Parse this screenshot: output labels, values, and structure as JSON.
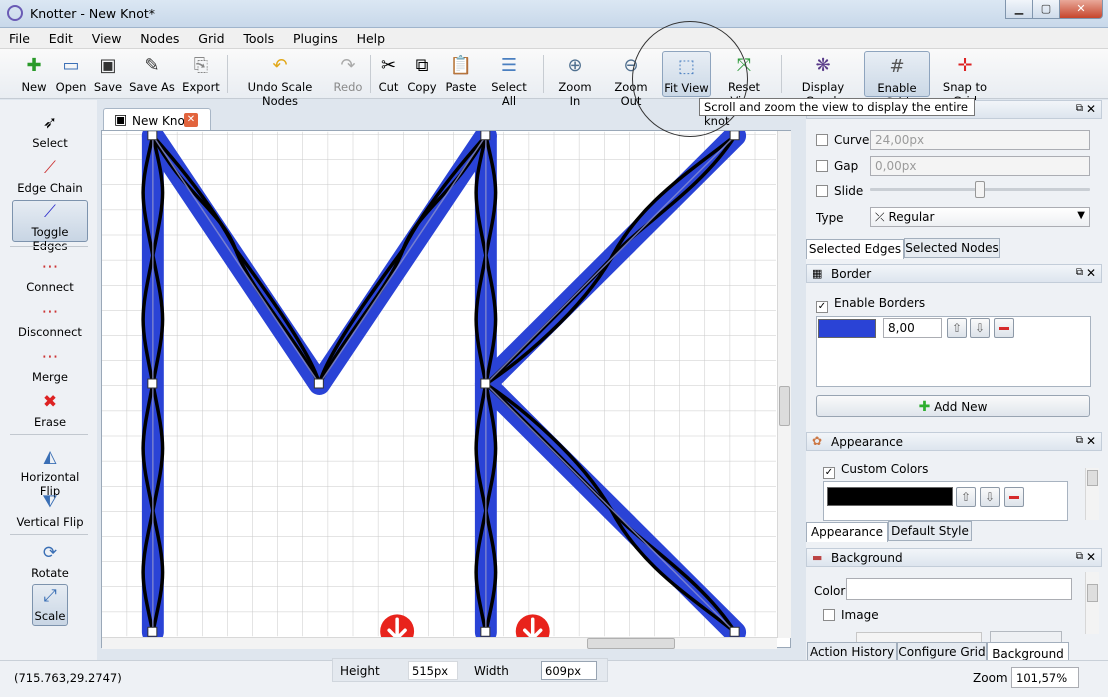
{
  "window": {
    "title": "Knotter - New Knot*",
    "min": "▁",
    "max": "▢",
    "close": "✕"
  },
  "menu": [
    "File",
    "Edit",
    "View",
    "Nodes",
    "Grid",
    "Tools",
    "Plugins",
    "Help"
  ],
  "toolbar": {
    "new": "New",
    "open": "Open",
    "save": "Save",
    "save_as": "Save As",
    "export": "Export",
    "undo": "Undo Scale Nodes",
    "redo": "Redo",
    "cut": "Cut",
    "copy": "Copy",
    "paste": "Paste",
    "select_all": "Select All",
    "zoom_in": "Zoom In",
    "zoom_out": "Zoom Out",
    "fit_view": "Fit View",
    "reset_view": "Reset View",
    "display_graph": "Display Graph",
    "enable_grid": "Enable Grid",
    "snap_to_grid": "Snap to Grid"
  },
  "tooltip": "Scroll and zoom the view to display the entire knot",
  "tools": {
    "select": "Select",
    "edge_chain": "Edge Chain",
    "toggle_edges": "Toggle Edges",
    "connect": "Connect",
    "disconnect": "Disconnect",
    "merge": "Merge",
    "erase": "Erase",
    "horizontal_flip": "Horizontal Flip",
    "vertical_flip": "Vertical Flip",
    "rotate": "Rotate",
    "scale": "Scale"
  },
  "document_tab": "New Knot",
  "edge_panel": {
    "curve_label": "Curve",
    "curve_value": "24,00px",
    "gap_label": "Gap",
    "gap_value": "0,00px",
    "slide_label": "Slide",
    "slide_level": 0.5,
    "type_label": "Type",
    "type_value": "Regular",
    "tab_selected_edges": "Selected Edges",
    "tab_selected_nodes": "Selected Nodes"
  },
  "border_panel": {
    "title": "Border",
    "enable_borders": "Enable Borders",
    "width_value": "8,00",
    "color": "#2a43d6",
    "add_new": "Add New"
  },
  "appearance_panel": {
    "title": "Appearance",
    "custom_colors": "Custom Colors",
    "color": "#000000",
    "tab_appearance": "Appearance",
    "tab_default_style": "Default Style"
  },
  "background_panel": {
    "title": "Background",
    "color_label": "Color",
    "image_label": "Image"
  },
  "bottom_tabs": {
    "action_history": "Action History",
    "configure_grid": "Configure Grid",
    "background": "Background"
  },
  "status": {
    "coords": "(715.763,29.2747)",
    "height_label": "Height",
    "height_value": "515px",
    "width_label": "Width",
    "width_value": "609px",
    "zoom_label": "Zoom",
    "zoom_value": "101,57%"
  },
  "colors": {
    "knot_border": "#2a43d6",
    "knot_fill": "#000000",
    "accent_red": "#e8231c"
  }
}
